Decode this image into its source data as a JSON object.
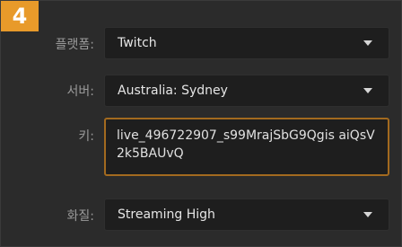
{
  "step_badge": "4",
  "rows": {
    "platform": {
      "label": "플랫폼:",
      "value": "Twitch"
    },
    "server": {
      "label": "서버:",
      "value": "Australia: Sydney"
    },
    "key": {
      "label": "키:",
      "value": "live_496722907_s99MrajSbG9Qgis aiQsV2k5BAUvQ"
    },
    "quality": {
      "label": "화질:",
      "value": "Streaming High"
    }
  },
  "colors": {
    "accent": "#e89a2a",
    "key_border": "#a36a1f",
    "background": "#2b2b2b",
    "field": "#1e1e1e"
  }
}
